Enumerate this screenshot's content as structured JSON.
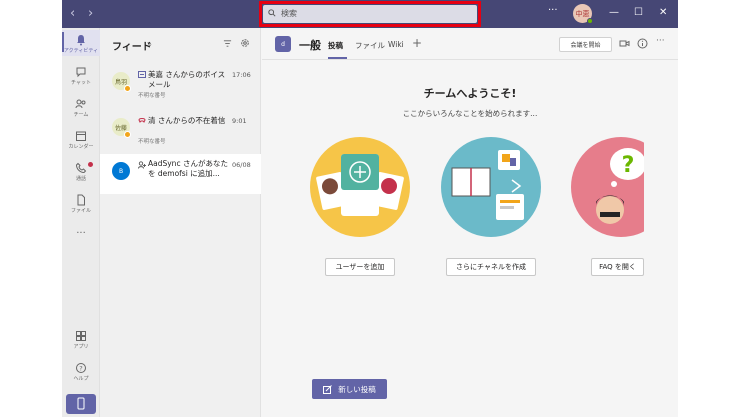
{
  "search": {
    "placeholder": "検索"
  },
  "titlebar": {
    "more": "···",
    "avatar_initials": "中恵",
    "minimize": "—",
    "maximize": "☐",
    "close": "✕"
  },
  "rail": {
    "items": [
      {
        "label": "アクティビティ"
      },
      {
        "label": "チャット"
      },
      {
        "label": "チーム"
      },
      {
        "label": "カレンダー"
      },
      {
        "label": "通話"
      },
      {
        "label": "ファイル"
      },
      {
        "label": "アプリ"
      },
      {
        "label": "ヘルプ"
      }
    ],
    "more": "···"
  },
  "feed": {
    "title": "フィード",
    "items": [
      {
        "avatar": "鳥羽",
        "title": "美嘉 さんからのボイスメール",
        "subtitle": "不明な番号",
        "time": "17:06"
      },
      {
        "avatar": "佐藤",
        "title": "清 さんからの不在着信",
        "subtitle": "不明な番号",
        "time": "9:01"
      },
      {
        "avatar": "B",
        "title": "AadSync さんがあなたを demofsi に追加...",
        "subtitle": "",
        "time": "06/08"
      }
    ]
  },
  "channel": {
    "team_initial": "d",
    "name": "一般",
    "tabs": [
      "投稿",
      "ファイル",
      "Wiki"
    ],
    "add_tab": "+",
    "meet_label": "会議を開始",
    "more": "···"
  },
  "welcome": {
    "title": "チームへようこそ!",
    "subtitle": "ここからいろんなことを始められます...",
    "actions": [
      {
        "label": "ユーザーを追加"
      },
      {
        "label": "さらにチャネルを作成"
      },
      {
        "label": "FAQ を開く"
      }
    ],
    "new_post": "新しい投稿"
  },
  "colors": {
    "brand": "#6264a7",
    "titlebar": "#464775",
    "highlight": "#e60012"
  }
}
